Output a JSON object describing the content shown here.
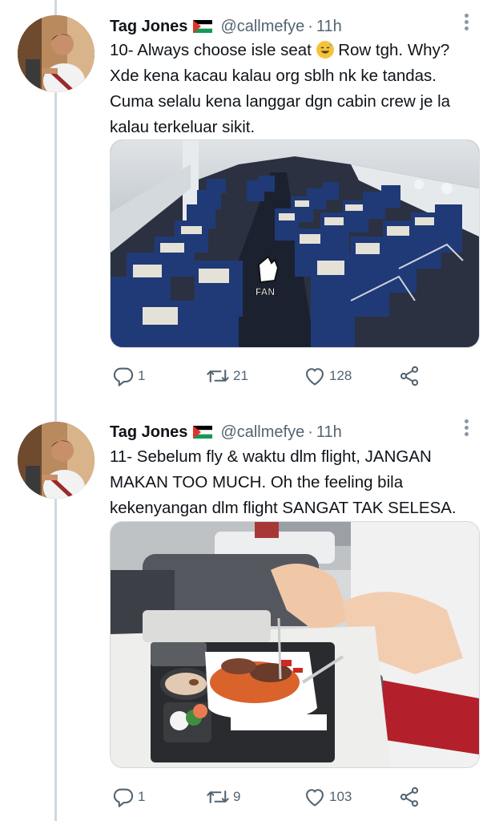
{
  "tweets": [
    {
      "author": {
        "name": "Tag Jones",
        "handle": "@callmefye",
        "flag_icon": "palestine-flag-icon"
      },
      "time": "11h",
      "text_lines": [
        "10- Always choose isle seat",
        " Row tgh. Why?",
        "Xde kena kacau kalau org sblh nk ke tandas.",
        "Cuma selalu kena langgar dgn cabin crew je la",
        "kalau terkeluar sikit."
      ],
      "emoji": "sweat-smile-emoji",
      "image": {
        "subject": "airplane-cabin-seats",
        "sticker_text": "FAN"
      },
      "stats": {
        "replies": "1",
        "retweets": "21",
        "likes": "128"
      }
    },
    {
      "author": {
        "name": "Tag Jones",
        "handle": "@callmefye",
        "flag_icon": "palestine-flag-icon"
      },
      "time": "11h",
      "text_lines": [
        "11- Sebelum fly & waktu dlm flight, JANGAN",
        "MAKAN TOO MUCH. Oh the feeling bila",
        "kekenyangan dlm flight SANGAT TAK SELESA."
      ],
      "image": {
        "subject": "in-flight-meal-tray"
      },
      "stats": {
        "replies": "1",
        "retweets": "9",
        "likes": "103"
      }
    }
  ],
  "separator_dot": "·",
  "colors": {
    "text": "#0f1419",
    "secondary": "#536471",
    "thread_line": "#cfd9de"
  }
}
